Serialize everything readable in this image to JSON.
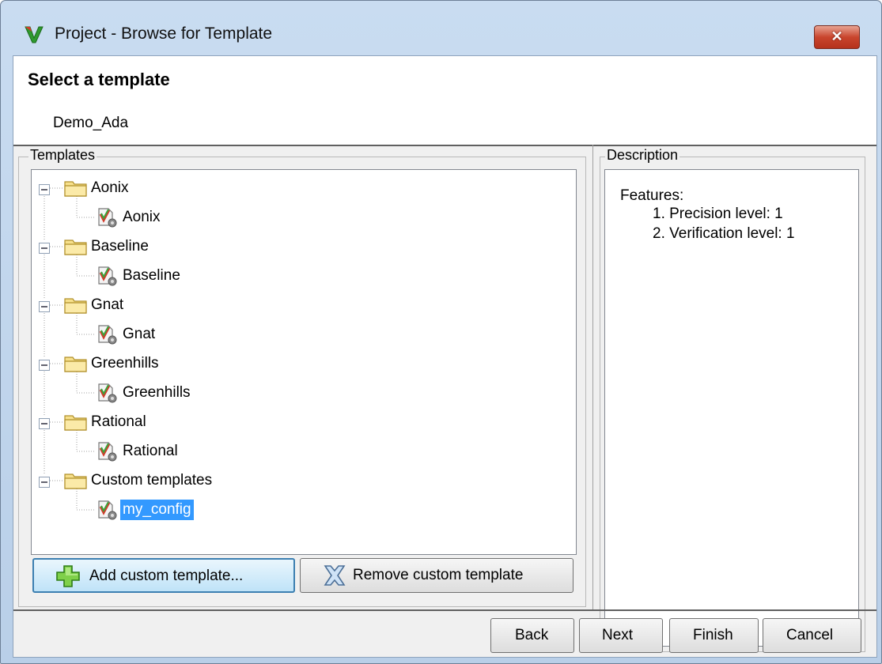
{
  "window": {
    "title": "Project - Browse for Template",
    "close_glyph": "✕"
  },
  "header": {
    "heading": "Select a template",
    "project_name": "Demo_Ada"
  },
  "templates_group": {
    "label": "Templates",
    "tree": [
      {
        "folder": "Aonix",
        "child": "Aonix"
      },
      {
        "folder": "Baseline",
        "child": "Baseline"
      },
      {
        "folder": "Gnat",
        "child": "Gnat"
      },
      {
        "folder": "Greenhills",
        "child": "Greenhills"
      },
      {
        "folder": "Rational",
        "child": "Rational"
      },
      {
        "folder": "Custom templates",
        "child": "my_config"
      }
    ],
    "selected_item": "my_config",
    "add_button": "Add custom template...",
    "remove_button": "Remove custom template"
  },
  "description_group": {
    "label": "Description",
    "title": "Features:",
    "items": [
      "1. Precision level: 1",
      "2. Verification level: 1"
    ]
  },
  "footer": {
    "back": "Back",
    "next": "Next",
    "finish": "Finish",
    "cancel": "Cancel"
  },
  "colors": {
    "selection": "#3399ff",
    "close_button": "#c9452d",
    "frame": "#b9cfe8"
  },
  "icons": [
    "app-logo-icon",
    "expand-collapse-icon",
    "folder-icon",
    "template-file-icon",
    "add-plus-icon",
    "remove-x-icon"
  ]
}
